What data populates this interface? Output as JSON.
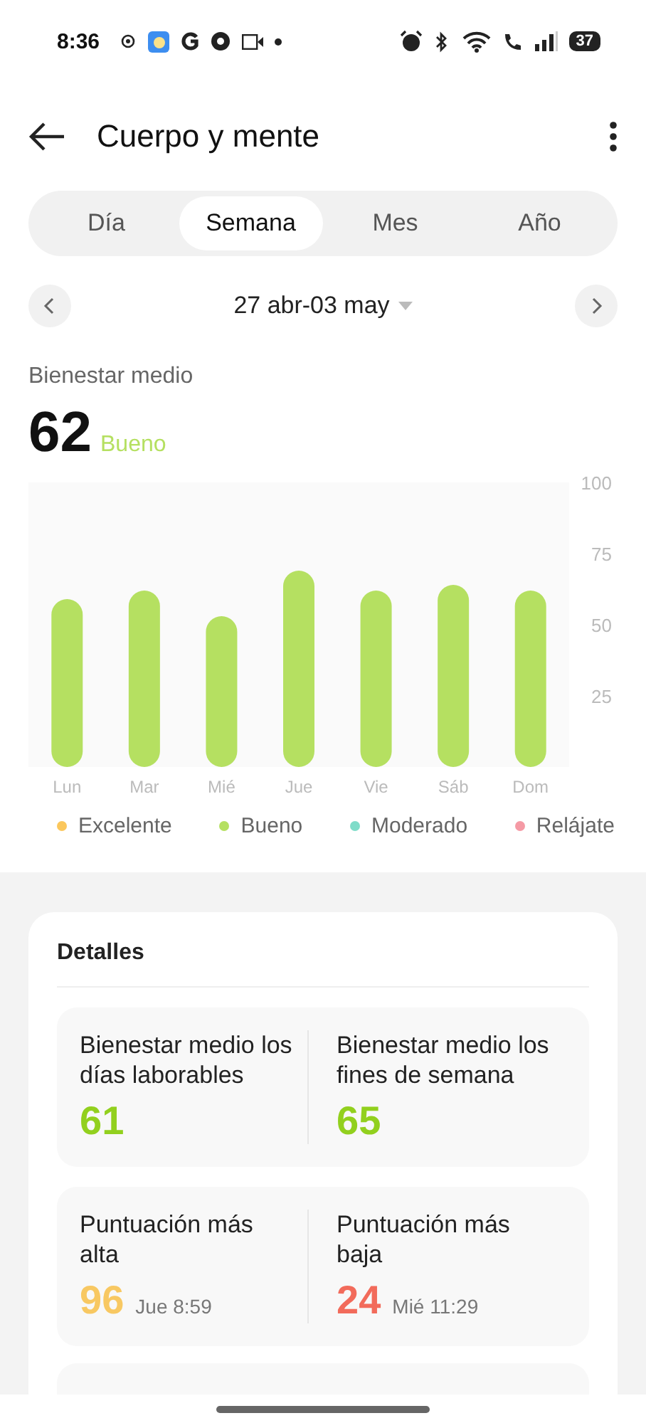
{
  "status_bar": {
    "time": "8:36",
    "battery": "37"
  },
  "header": {
    "title": "Cuerpo y mente"
  },
  "tabs": [
    {
      "label": "Día",
      "selected": false
    },
    {
      "label": "Semana",
      "selected": true
    },
    {
      "label": "Mes",
      "selected": false
    },
    {
      "label": "Año",
      "selected": false
    }
  ],
  "date_range": {
    "label": "27 abr-03 may"
  },
  "summary": {
    "title": "Bienestar medio",
    "value": "62",
    "rating": "Bueno",
    "chart_data": {
      "type": "bar",
      "categories": [
        "Lun",
        "Mar",
        "Mié",
        "Jue",
        "Vie",
        "Sáb",
        "Dom"
      ],
      "values": [
        59,
        62,
        53,
        69,
        62,
        64,
        62
      ],
      "ylim": [
        0,
        100
      ],
      "yticks": [
        25,
        50,
        75,
        100
      ]
    }
  },
  "legend": [
    {
      "label": "Excelente",
      "color": "#fbc75c"
    },
    {
      "label": "Bueno",
      "color": "#b5e061"
    },
    {
      "label": "Moderado",
      "color": "#7fdcc9"
    },
    {
      "label": "Relájate",
      "color": "#f59aa5"
    }
  ],
  "details": {
    "title": "Detalles",
    "groups": [
      {
        "items": [
          {
            "label": "Bienestar medio los días laborables",
            "value": "61",
            "color": "#92d01e"
          },
          {
            "label": "Bienestar medio los fines de semana",
            "value": "65",
            "color": "#92d01e"
          }
        ]
      },
      {
        "items": [
          {
            "label": "Puntuación más alta",
            "value": "96",
            "time": "Jue 8:59",
            "color": "#f8c862"
          },
          {
            "label": "Puntuación más baja",
            "value": "24",
            "time": "Mié 11:29",
            "color": "#f26b5b"
          }
        ]
      }
    ]
  }
}
